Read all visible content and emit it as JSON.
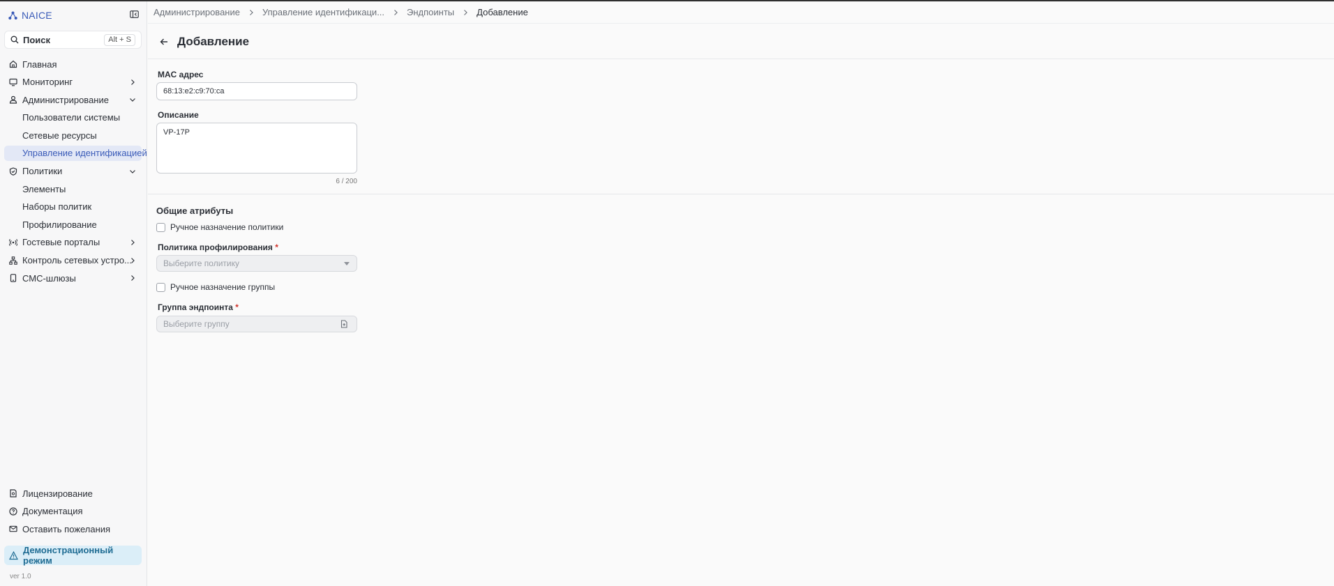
{
  "app": {
    "brand": "NAICE",
    "version": "ver 1.0"
  },
  "search": {
    "label": "Поиск",
    "shortcut": "Alt + S"
  },
  "sidebar": {
    "items": [
      {
        "label": "Главная"
      },
      {
        "label": "Мониторинг"
      },
      {
        "label": "Администрирование"
      },
      {
        "label": "Пользователи системы"
      },
      {
        "label": "Сетевые ресурсы"
      },
      {
        "label": "Управление идентификацией"
      },
      {
        "label": "Политики"
      },
      {
        "label": "Элементы"
      },
      {
        "label": "Наборы политик"
      },
      {
        "label": "Профилирование"
      },
      {
        "label": "Гостевые порталы"
      },
      {
        "label": "Контроль сетевых устро..."
      },
      {
        "label": "СМС-шлюзы"
      }
    ],
    "bottom": [
      {
        "label": "Лицензирование"
      },
      {
        "label": "Документация"
      },
      {
        "label": "Оставить пожелания"
      }
    ],
    "demo_label": "Демонстрационный режим"
  },
  "breadcrumb": [
    "Администрирование",
    "Управление идентификаци...",
    "Эндпоинты",
    "Добавление"
  ],
  "page": {
    "title": "Добавление"
  },
  "form": {
    "mac_label": "MAC адрес",
    "mac_value": "68:13:e2:c9:70:ca",
    "desc_label": "Описание",
    "desc_value": "VP-17P",
    "desc_counter": "6 / 200",
    "section_title": "Общие атрибуты",
    "manual_policy_label": "Ручное назначение политики",
    "profiling_policy_label": "Политика профилирования",
    "profiling_policy_placeholder": "Выберите политику",
    "manual_group_label": "Ручное назначение группы",
    "endpoint_group_label": "Группа эндпоинта",
    "endpoint_group_placeholder": "Выберите группу",
    "required_mark": "*"
  },
  "colors": {
    "accent": "#3a5bb8",
    "demo_bg": "#dbeef8",
    "required": "#d0342c"
  }
}
